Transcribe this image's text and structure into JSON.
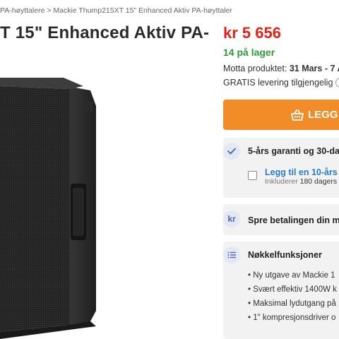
{
  "breadcrumb": {
    "item1": "PA-høyttalere",
    "sep1": ">",
    "item2": "Mackie Thump215XT 15\" Enhanced Aktiv PA-høyttaler"
  },
  "product": {
    "title": "T 15\" Enhanced Aktiv PA-"
  },
  "price": "kr 5 656",
  "stock": "14 på lager",
  "delivery": {
    "label": "Motta produktet: ",
    "dates": "31 Mars - 7 A"
  },
  "shipping": "GRATIS levering tilgjengelig",
  "buy_button": "LEGG",
  "warranty": {
    "title": "5-års garanti og 30-dag",
    "addon_link": "Legg til en 10-års",
    "addon_sub_prefix": "Inkluderer",
    "addon_sub_value": "180 dagers"
  },
  "payment": {
    "icon_text": "kr",
    "title": "Spre betalingen din m"
  },
  "features": {
    "title": "Nøkkelfunksjoner",
    "items": [
      "Ny utgave av Mackie 1",
      "Svært effektiv 1400W k",
      "Maksimal lydutgang på",
      "1\" kompresjonsdriver o"
    ]
  },
  "colors": {
    "price": "#e2231a",
    "stock": "#2e9a3a",
    "button": "#f28c28",
    "link": "#2a7dc6"
  }
}
